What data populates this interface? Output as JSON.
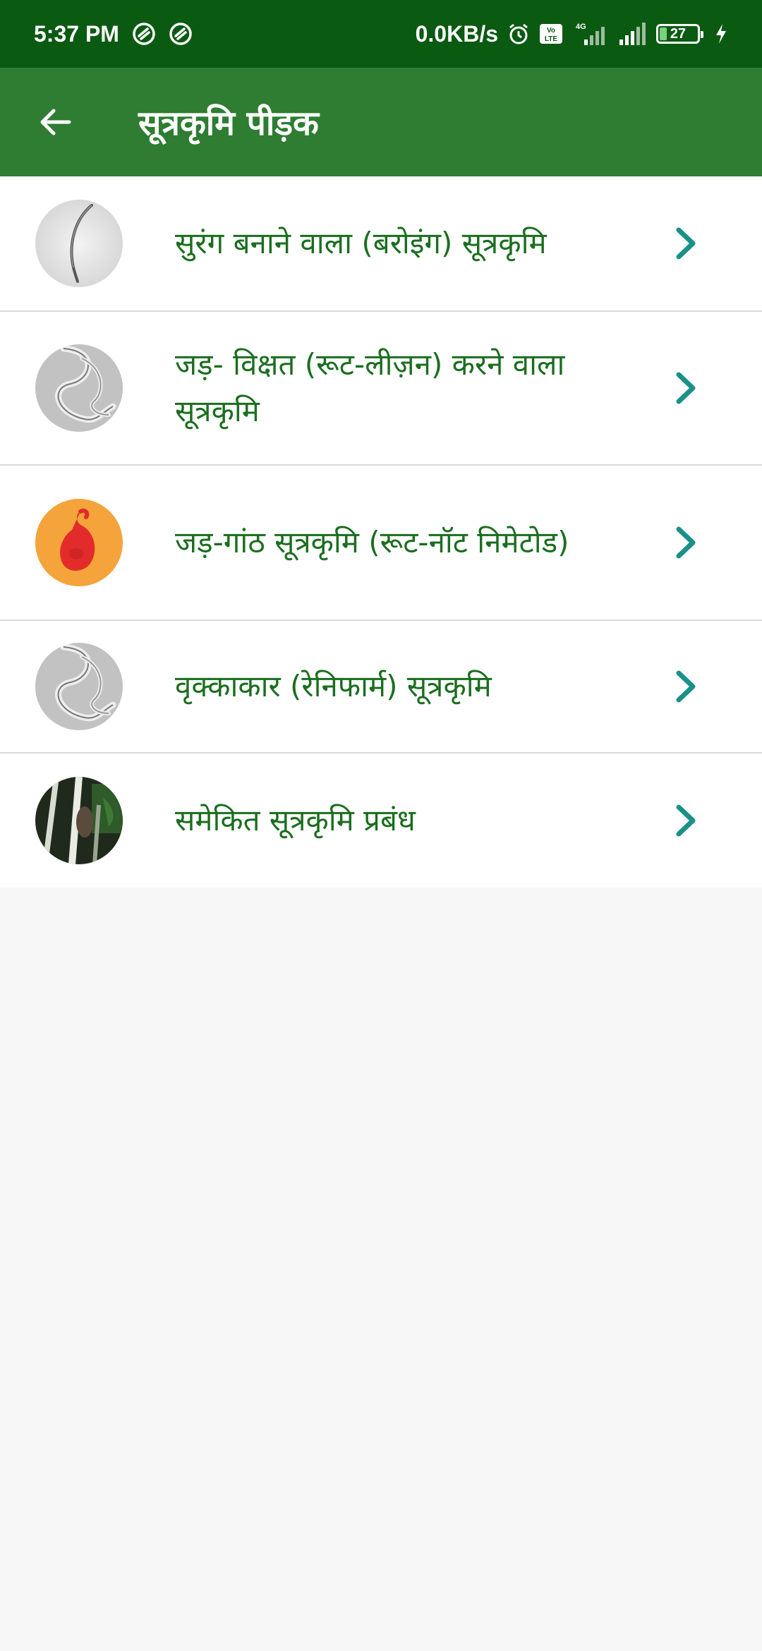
{
  "status_bar": {
    "time": "5:37 PM",
    "net_speed": "0.0KB/s",
    "battery": "27",
    "network": "4G",
    "volte": "Vo LTE"
  },
  "app_bar": {
    "title": "सूत्रकृमि पीड़क"
  },
  "list": {
    "items": [
      {
        "label": "सुरंग बनाने वाला (बरोइंग) सूत्रकृमि",
        "thumb": "burrowing-nematode-image"
      },
      {
        "label": "जड़- विक्षत (रूट-लीज़न) करने वाला सूत्रकृमि",
        "thumb": "root-lesion-nematode-image"
      },
      {
        "label": "जड़-गांठ सूत्रकृमि (रूट-नॉट निमेटोड)",
        "thumb": "root-knot-nematode-image"
      },
      {
        "label": "वृक्काकार (रेनिफार्म) सूत्रकृमि",
        "thumb": "reniform-nematode-image"
      },
      {
        "label": "समेकित सूत्रकृमि प्रबंध",
        "thumb": "integrated-management-image"
      }
    ]
  },
  "colors": {
    "status_bar": "#0b5a12",
    "app_bar": "#2e7d32",
    "item_text": "#1b6e1f",
    "chevron": "#1a9188",
    "background": "#f7f7f7"
  }
}
